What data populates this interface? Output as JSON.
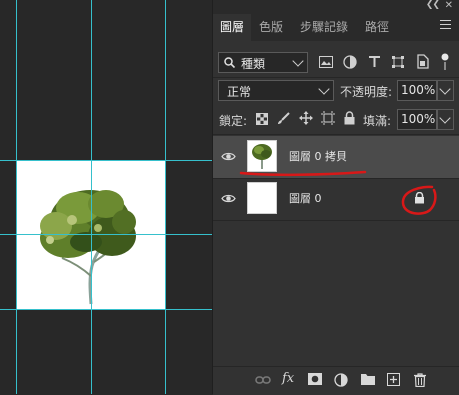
{
  "panel": {
    "tabs": [
      {
        "label": "圖層",
        "active": true
      },
      {
        "label": "色版",
        "active": false
      },
      {
        "label": "步驟記錄",
        "active": false
      },
      {
        "label": "路徑",
        "active": false
      }
    ],
    "collapse_icon": "double-chevron-icon",
    "close_icon": "close-icon",
    "menu_icon": "panel-menu-icon"
  },
  "filter": {
    "kind_label": "種類",
    "icons": [
      "pixel-filter-icon",
      "adjustment-filter-icon",
      "type-filter-icon",
      "shape-filter-icon",
      "smart-object-filter-icon",
      "filter-toggle-icon"
    ]
  },
  "blend": {
    "mode": "正常",
    "opacity_label": "不透明度:",
    "opacity_value": "100%"
  },
  "lock_row": {
    "label": "鎖定:",
    "icons": [
      "lock-transparent-icon",
      "lock-image-icon",
      "lock-position-icon",
      "lock-artboard-icon",
      "lock-all-icon"
    ],
    "fill_label": "填滿:",
    "fill_value": "100%"
  },
  "layers": [
    {
      "name": "圖層 0 拷貝",
      "visible": true,
      "selected": true,
      "has_tree": true,
      "locked": false
    },
    {
      "name": "圖層 0",
      "visible": true,
      "selected": false,
      "has_tree": false,
      "locked": true
    }
  ],
  "bottom_icons": [
    "link-layers-icon",
    "fx-icon",
    "add-mask-icon",
    "adjustment-layer-icon",
    "new-group-icon",
    "new-layer-icon",
    "delete-layer-icon"
  ],
  "bottom_fx_label": "fx",
  "annotations": {
    "color": "#d81818"
  },
  "colors": {
    "guide": "#36c0cc",
    "panel_bg": "#323232",
    "selected_layer": "#4b4b4b"
  }
}
